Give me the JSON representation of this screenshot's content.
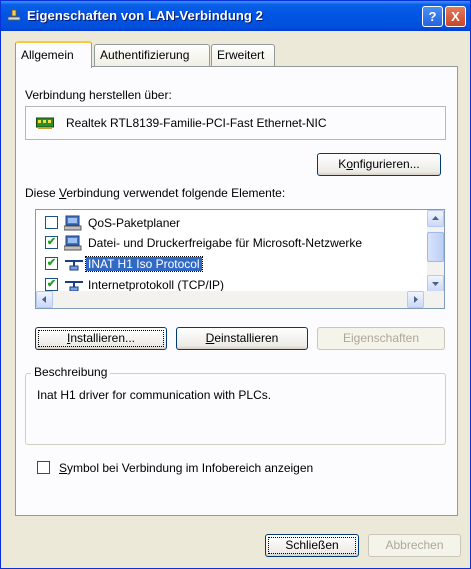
{
  "window": {
    "title": "Eigenschaften von LAN-Verbindung 2",
    "help_label": "?",
    "close_label": "X"
  },
  "tabs": [
    {
      "label": "Allgemein"
    },
    {
      "label": "Authentifizierung"
    },
    {
      "label": "Erweitert"
    }
  ],
  "general": {
    "connect_using_label": "Verbindung herstellen über:",
    "adapter_name": "Realtek RTL8139-Familie-PCI-Fast Ethernet-NIC",
    "configure_pre": "K",
    "configure_key": "o",
    "configure_post": "nfigurieren...",
    "components_pre": "Diese ",
    "components_key": "V",
    "components_post": "erbindung verwendet folgende Elemente:",
    "components": [
      {
        "label": "QoS-Paketplaner",
        "checked": false,
        "icon": "network-service-icon"
      },
      {
        "label": "Datei- und Druckerfreigabe für Microsoft-Netzwerke",
        "checked": true,
        "icon": "network-service-icon"
      },
      {
        "label": "INAT H1 Iso Protocol",
        "checked": true,
        "icon": "protocol-icon"
      },
      {
        "label": "Internetprotokoll (TCP/IP)",
        "checked": true,
        "icon": "protocol-icon"
      }
    ],
    "install_pre": "",
    "install_key": "I",
    "install_post": "nstallieren...",
    "uninstall_pre": "",
    "uninstall_key": "D",
    "uninstall_post": "einstallieren",
    "properties_label": "Eigenschaften",
    "description_title": "Beschreibung",
    "description_text": "Inat H1 driver for communication with PLCs.",
    "show_icon_pre": "",
    "show_icon_key": "S",
    "show_icon_post": "ymbol bei Verbindung im Infobereich anzeigen"
  },
  "footer": {
    "close_label": "Schließen",
    "cancel_label": "Abbrechen"
  },
  "colors": {
    "titlebar": "#0054e3",
    "selection": "#316ac5",
    "check": "#21a121"
  }
}
